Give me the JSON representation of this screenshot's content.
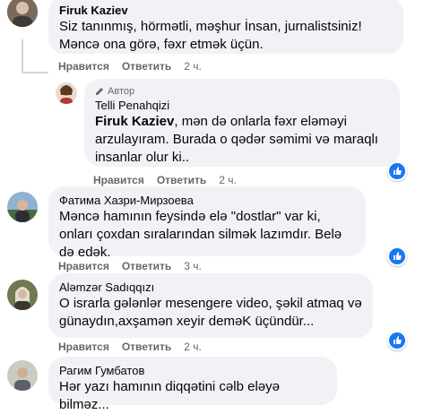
{
  "comments": [
    {
      "name": "Firuk Kaziev",
      "text": "Siz tanınmış, hörmətli, məşhur İnsan, jurnalistsiniz! Məncə ona görə, fəxr etmək üçün.",
      "like": "Нравится",
      "reply": "Ответить",
      "time": "2 ч."
    },
    {
      "badge": "Автор",
      "name": "Telli Penahqizi",
      "mention": "Firuk Kaziev",
      "text": ", mən də onlarla fəxr eləməyi arzulayıram. Burada o qədər səmimi və maraqlı insanlar olur ki..",
      "like": "Нравится",
      "reply": "Ответить",
      "time": "2 ч."
    },
    {
      "name": "Фатима Хазри-Мирзоева",
      "text": "Məncə hamının feysində elə \"dostlar\" var ki, onları çoxdan sıralarından silmək lazımdır. Belə də edək.",
      "like": "Нравится",
      "reply": "Ответить",
      "time": "3 ч."
    },
    {
      "name": "Aləmzər Sadıqqızı",
      "text": "O israrla gələnlər mesengere video, şəkil atmaq və günaydın,axşamən xeyir deməK üçündür...",
      "like": "Нравится",
      "reply": "Ответить",
      "time": "2 ч."
    },
    {
      "name": "Рагим Гумбатов",
      "text": "Hər yazı hamının diqqətini cəlb eləyə bilməz..."
    }
  ],
  "colors": {
    "bubble": "#f0f2f5",
    "meta": "#65676b",
    "like_blue": "#1877f2"
  },
  "icons": [
    "pencil-icon",
    "like-thumb-icon"
  ]
}
